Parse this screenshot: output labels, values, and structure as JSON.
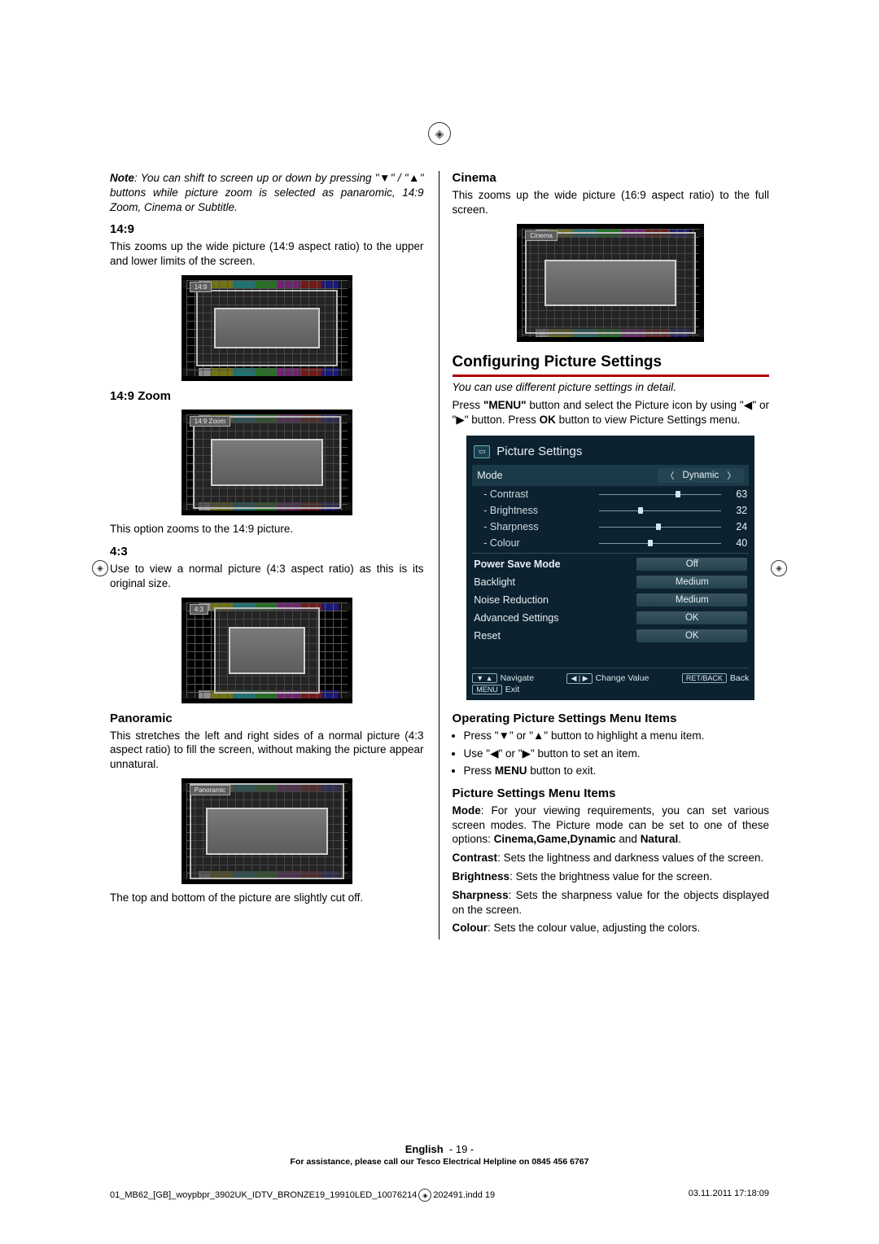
{
  "left": {
    "note_prefix": "Note",
    "note_text": ": You can shift to screen up or down by pressing \"▼\" / \"▲\" buttons while picture zoom is selected as panaromic, 14:9 Zoom, Cinema or Subtitle.",
    "h_149": "14:9",
    "p_149": "This zooms up the wide picture (14:9 aspect ratio) to the upper and lower limits of the screen.",
    "label_149": "14:9",
    "h_149zoom": "14:9 Zoom",
    "label_149zoom": "14:9 Zoom",
    "p_149zoom": "This option zooms to the 14:9 picture.",
    "h_43": "4:3",
    "p_43": "Use to view a normal picture (4:3 aspect ratio) as this is its original size.",
    "label_43": "4:3",
    "h_pano": "Panoramic",
    "p_pano": "This stretches the left and right sides of a normal picture (4:3 aspect ratio) to fill the screen, without making the picture appear unnatural.",
    "label_pano": "Panoramic",
    "p_pano_tail": "The top and bottom of the picture are slightly cut off."
  },
  "right": {
    "h_cinema": "Cinema",
    "p_cinema": "This zooms up the wide picture (16:9 aspect ratio) to the full screen.",
    "label_cinema": "Cinema",
    "h_config": "Configuring Picture Settings",
    "p_intro_italic": "You can use different picture settings in detail.",
    "p_press_menu": "Press \"MENU\" button and select the Picture icon by using \"◀\" or \"▶\" button. Press OK button to view Picture Settings menu.",
    "menu": {
      "title": "Picture Settings",
      "mode_label": "Mode",
      "mode_value": "Dynamic",
      "contrast_label": "- Contrast",
      "contrast_value": "63",
      "brightness_label": "- Brightness",
      "brightness_value": "32",
      "sharpness_label": "- Sharpness",
      "sharpness_value": "24",
      "colour_label": "- Colour",
      "colour_value": "40",
      "psm_label": "Power Save Mode",
      "psm_value": "Off",
      "backlight_label": "Backlight",
      "backlight_value": "Medium",
      "nr_label": "Noise Reduction",
      "nr_value": "Medium",
      "adv_label": "Advanced Settings",
      "adv_value": "OK",
      "reset_label": "Reset",
      "reset_value": "OK",
      "nav_hint": "Navigate",
      "change_hint": "Change Value",
      "back_hint": "Back",
      "back_key": "RET/BACK",
      "exit_hint": "Exit",
      "exit_key": "MENU"
    },
    "h_operating": "Operating Picture Settings Menu Items",
    "b1": "Press \"▼\" or \"▲\" button to highlight a menu item.",
    "b2": "Use \"◀\" or \"▶\" button to set an item.",
    "b3_prefix": "Press ",
    "b3_bold": "MENU",
    "b3_tail": " button to exit.",
    "h_items": "Picture Settings Menu Items",
    "mode_bold": "Mode",
    "mode_text": ": For your viewing requirements, you can set various screen modes. The Picture mode can be set to one of these options: ",
    "mode_opts": "Cinema,Game,Dynamic",
    "mode_and": " and ",
    "mode_last": "Natural",
    "mode_period": ".",
    "contrast_bold": "Contrast",
    "contrast_text": ": Sets the lightness and darkness values of the screen.",
    "brightness_bold": "Brightness",
    "brightness_text": ": Sets the brightness value for the screen.",
    "sharpness_bold": "Sharpness",
    "sharpness_text": ": Sets the sharpness value for the objects displayed on the screen.",
    "colour_bold": "Colour",
    "colour_text": ": Sets the colour value, adjusting the colors."
  },
  "footer": {
    "lang": "English",
    "page_num": "- 19 -",
    "help": "For assistance, please call our Tesco Electrical Helpline on 0845 456 6767",
    "indd_left": "01_MB62_[GB]_woypbpr_3902UK_IDTV_BRONZE19_19910LED_10076214",
    "indd_left_tail": "202491.indd   19",
    "indd_right": "03.11.2011   17:18:09"
  }
}
